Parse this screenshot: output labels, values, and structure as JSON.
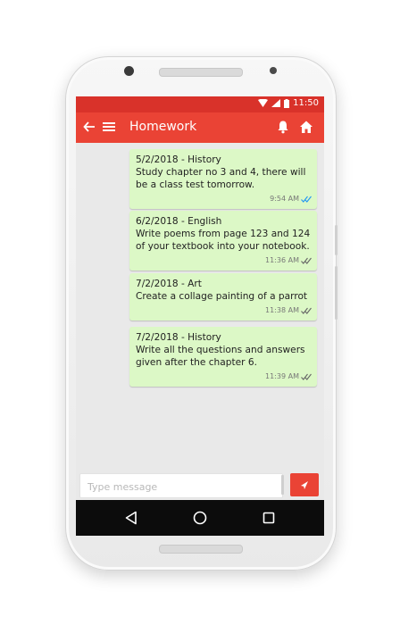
{
  "status": {
    "time": "11:50"
  },
  "appbar": {
    "title": "Homework",
    "back_icon": "back-arrow-icon",
    "menu_icon": "hamburger-menu-icon",
    "bell_icon": "bell-icon",
    "home_icon": "home-icon"
  },
  "messages": [
    {
      "header": "5/2/2018 - History",
      "text": "Study chapter no 3 and 4, there will be a class test tomorrow.",
      "time": "9:54 AM",
      "read": true
    },
    {
      "header": "6/2/2018 - English",
      "text": "Write poems from page 123 and 124 of your textbook into your notebook.",
      "time": "11:36 AM",
      "read": false
    },
    {
      "header": "7/2/2018 - Art",
      "text": "Create a collage painting of a parrot",
      "time": "11:38 AM",
      "read": false
    },
    {
      "header": "7/2/2018 - History",
      "text": "Write all the questions and answers given after the chapter 6.",
      "time": "11:39 AM",
      "read": false
    }
  ],
  "input": {
    "placeholder": "Type message",
    "value": ""
  },
  "colors": {
    "accent": "#ea4335",
    "statusbar": "#d9322a",
    "bubble": "#dcf8c6",
    "tick_read": "#2196f3",
    "tick_sent": "#666666"
  }
}
